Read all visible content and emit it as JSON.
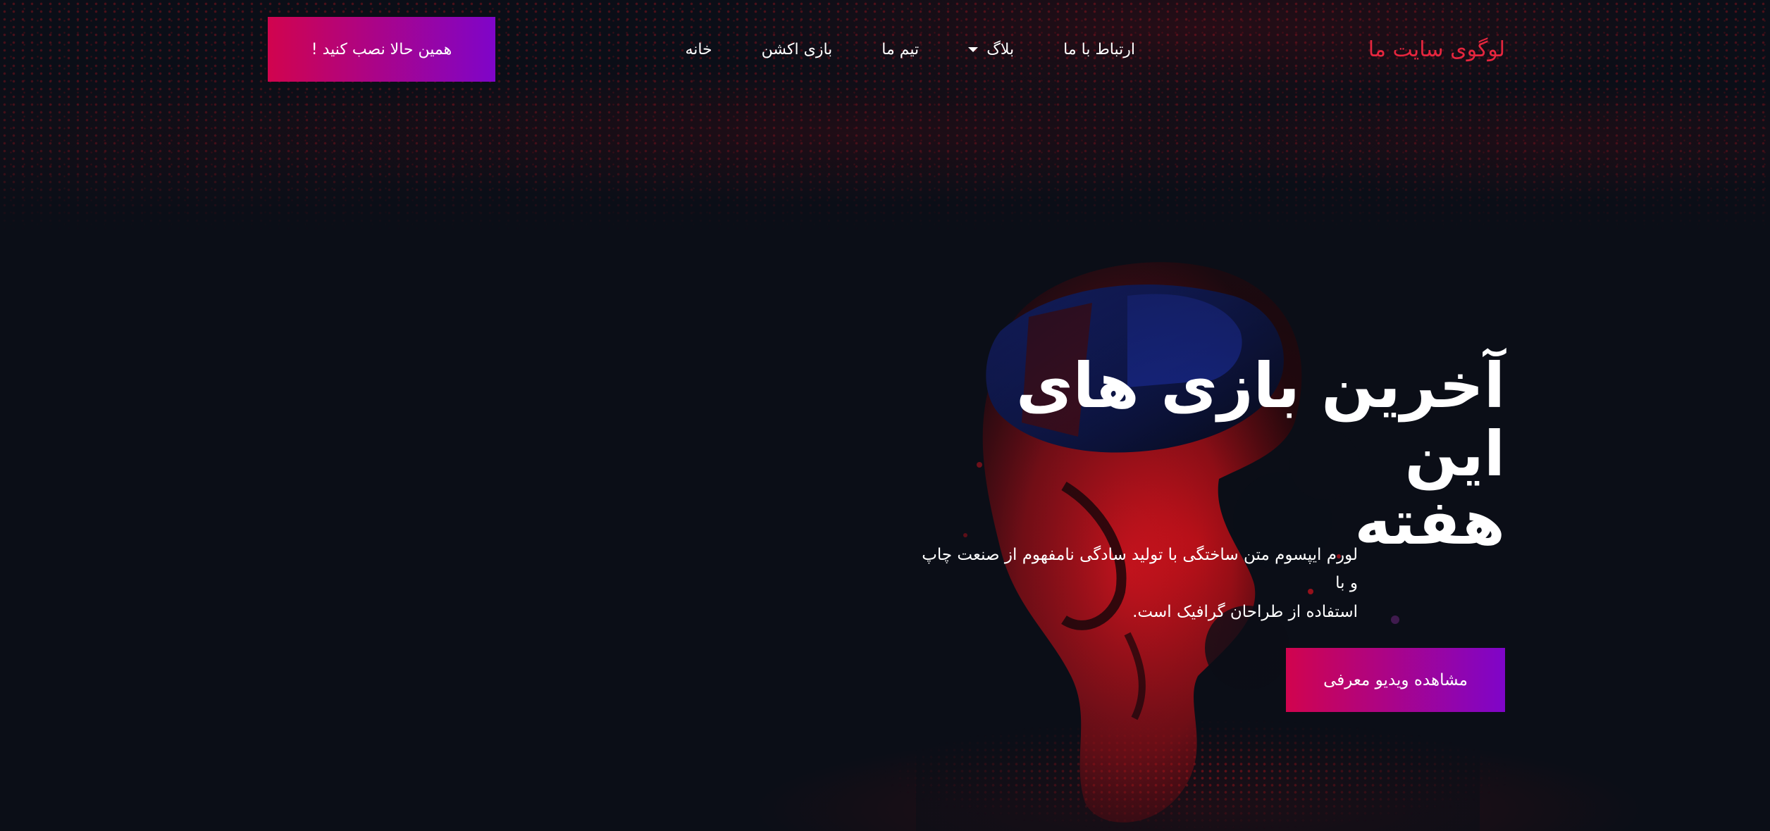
{
  "header": {
    "logo": "لوگوی سایت ما",
    "nav": [
      {
        "label": "خانه"
      },
      {
        "label": "بازی اکشن"
      },
      {
        "label": "تیم ما"
      },
      {
        "label": "بلاگ"
      },
      {
        "label": "ارتباط با ما"
      }
    ],
    "cta_label": "همین حالا نصب کنید !"
  },
  "hero": {
    "title_line1": "آخرین بازی های این",
    "title_line2": "هفته",
    "description_line1": "لورم ایپسوم متن ساختگی با تولید سادگی نامفهوم از صنعت چاپ و با",
    "description_line2": "استفاده از طراحان گرافیک است.",
    "cta_label": "مشاهده ویدیو معرفی"
  },
  "colors": {
    "background": "#0b0e17",
    "logo": "#e6263e",
    "gradient_start": "#d1044e",
    "gradient_end": "#7f05c9",
    "figure_red": "#c1121c",
    "headset_blue": "#1730a8"
  },
  "icons": {
    "dropdown": "caret-down-icon"
  }
}
